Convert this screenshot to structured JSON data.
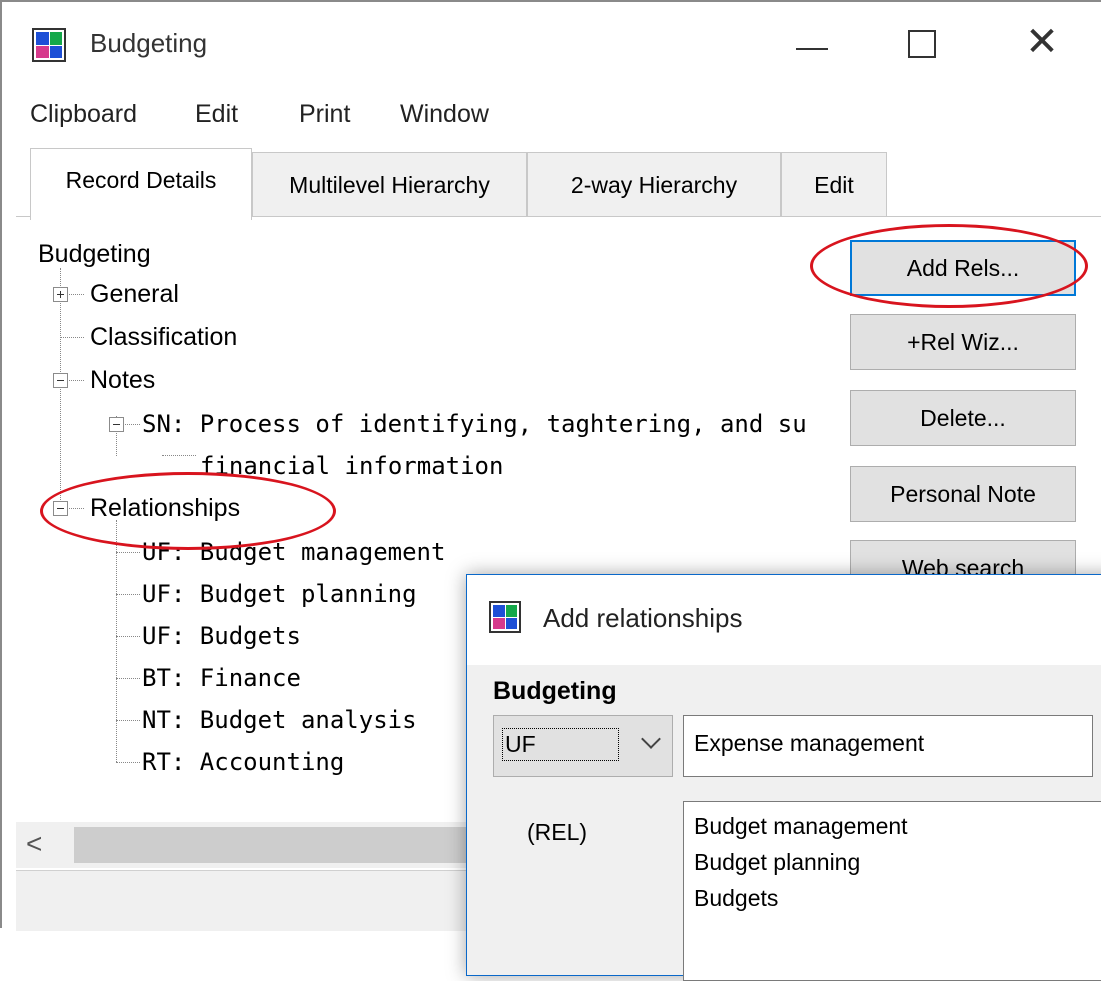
{
  "window": {
    "title": "Budgeting",
    "close_glyph": "✕"
  },
  "menu": [
    "Clipboard",
    "Edit",
    "Print",
    "Window"
  ],
  "tabs": [
    {
      "label": "Record Details",
      "active": true
    },
    {
      "label": "Multilevel Hierarchy",
      "active": false
    },
    {
      "label": "2-way Hierarchy",
      "active": false
    },
    {
      "label": "Edit",
      "active": false
    }
  ],
  "tree": {
    "root": "Budgeting",
    "general": "General",
    "classification": "Classification",
    "notes": "Notes",
    "note_line1": "SN: Process of identifying, taghtering, and su",
    "note_line2": "financial information",
    "relationships": "Relationships",
    "relations": [
      "UF: Budget management",
      "UF: Budget planning",
      "UF: Budgets",
      "BT: Finance",
      "NT: Budget analysis",
      "RT: Accounting"
    ]
  },
  "buttons": {
    "add_rels": "Add Rels...",
    "rel_wiz": "+Rel Wiz...",
    "delete": "Delete...",
    "personal_note": "Personal Note",
    "web_search": "Web search"
  },
  "scroll_left_glyph": "<",
  "dialog": {
    "title": "Add relationships",
    "term": "Budgeting",
    "rel_type": "UF",
    "term_value": "Expense management",
    "rel_label": "(REL)",
    "rel_list": [
      "Budget management",
      "Budget planning",
      "Budgets"
    ]
  },
  "colors": {
    "highlight_ring": "#d8141e",
    "focus_border": "#0078d7"
  }
}
